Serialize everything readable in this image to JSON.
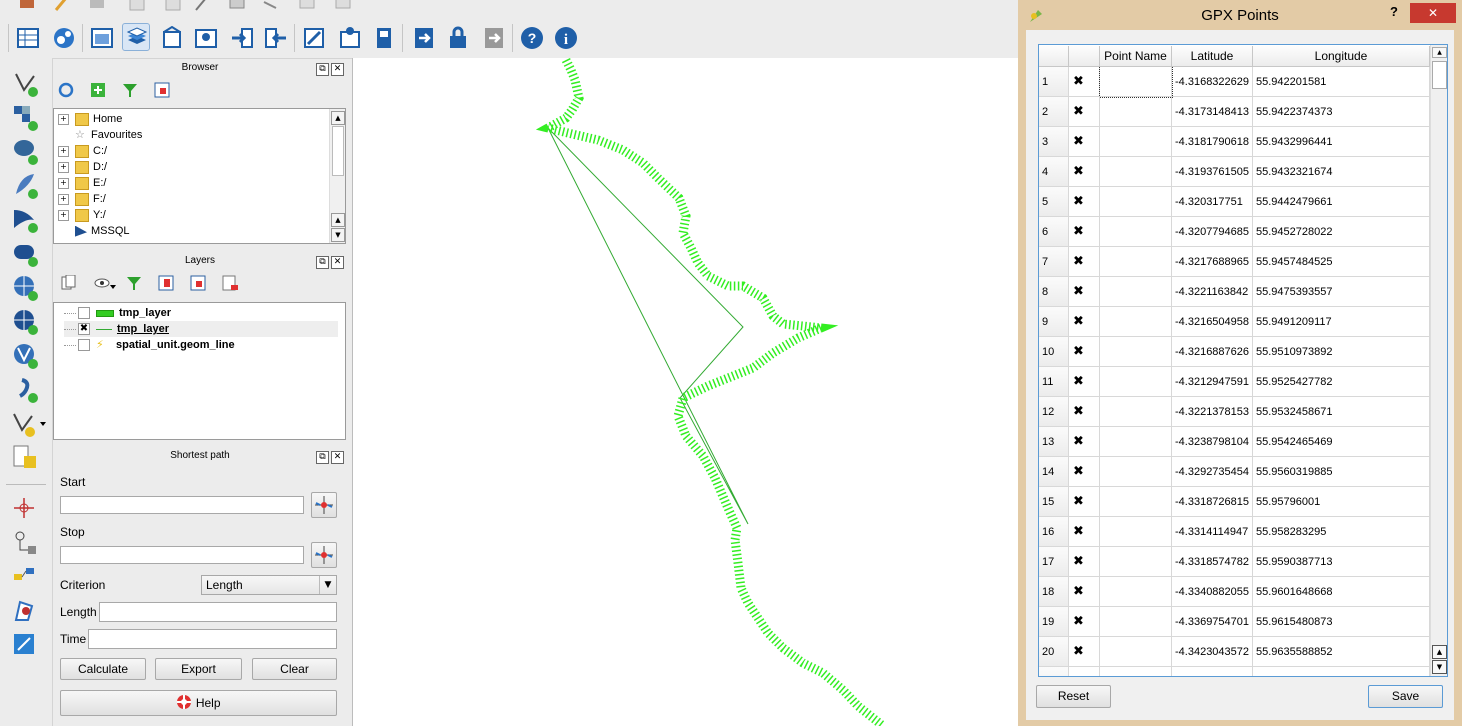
{
  "browser": {
    "title": "Browser",
    "items": [
      {
        "label": "Home",
        "expandable": true,
        "icon": "folder-icon"
      },
      {
        "label": "Favourites",
        "expandable": false,
        "icon": "star-icon"
      },
      {
        "label": "C:/",
        "expandable": true,
        "icon": "folder-icon"
      },
      {
        "label": "D:/",
        "expandable": true,
        "icon": "folder-icon"
      },
      {
        "label": "E:/",
        "expandable": true,
        "icon": "folder-icon"
      },
      {
        "label": "F:/",
        "expandable": true,
        "icon": "folder-icon"
      },
      {
        "label": "Y:/",
        "expandable": true,
        "icon": "folder-icon"
      },
      {
        "label": "MSSQL",
        "expandable": false,
        "icon": "mssql-icon"
      }
    ]
  },
  "layers": {
    "title": "Layers",
    "items": [
      {
        "label": "tmp_layer",
        "checked": false,
        "icon": "polygon-layer-icon"
      },
      {
        "label": "tmp_layer",
        "checked": true,
        "icon": "line-layer-icon"
      },
      {
        "label": "spatial_unit.geom_line",
        "checked": false,
        "icon": "line-layer-icon"
      }
    ]
  },
  "shortest_path": {
    "title": "Shortest path",
    "start_label": "Start",
    "start_value": "",
    "stop_label": "Stop",
    "stop_value": "",
    "criterion_label": "Criterion",
    "criterion_value": "Length",
    "length_label": "Length",
    "length_value": "",
    "time_label": "Time",
    "time_value": "",
    "calculate_label": "Calculate",
    "export_label": "Export",
    "clear_label": "Clear",
    "help_label": "Help"
  },
  "dialog": {
    "title": "GPX Points",
    "help_button": "?",
    "close_button": "✕",
    "columns": [
      "",
      "",
      "Point Name",
      "Latitude",
      "Longitude"
    ],
    "rows": [
      {
        "num": "1",
        "checked": true,
        "name": "",
        "lat": "-4.3168322629",
        "lon": "55.942201581"
      },
      {
        "num": "2",
        "checked": true,
        "name": "",
        "lat": "-4.3173148413",
        "lon": "55.9422374373"
      },
      {
        "num": "3",
        "checked": true,
        "name": "",
        "lat": "-4.3181790618",
        "lon": "55.9432996441"
      },
      {
        "num": "4",
        "checked": true,
        "name": "",
        "lat": "-4.3193761505",
        "lon": "55.9432321674"
      },
      {
        "num": "5",
        "checked": true,
        "name": "",
        "lat": "-4.320317751",
        "lon": "55.9442479661"
      },
      {
        "num": "6",
        "checked": true,
        "name": "",
        "lat": "-4.3207794685",
        "lon": "55.9452728022"
      },
      {
        "num": "7",
        "checked": true,
        "name": "",
        "lat": "-4.3217688965",
        "lon": "55.9457484525"
      },
      {
        "num": "8",
        "checked": true,
        "name": "",
        "lat": "-4.3221163842",
        "lon": "55.9475393557"
      },
      {
        "num": "9",
        "checked": true,
        "name": "",
        "lat": "-4.3216504958",
        "lon": "55.9491209117"
      },
      {
        "num": "10",
        "checked": true,
        "name": "",
        "lat": "-4.3216887626",
        "lon": "55.9510973892"
      },
      {
        "num": "11",
        "checked": true,
        "name": "",
        "lat": "-4.3212947591",
        "lon": "55.9525427782"
      },
      {
        "num": "12",
        "checked": true,
        "name": "",
        "lat": "-4.3221378153",
        "lon": "55.9532458671"
      },
      {
        "num": "13",
        "checked": true,
        "name": "",
        "lat": "-4.3238798104",
        "lon": "55.9542465469"
      },
      {
        "num": "14",
        "checked": true,
        "name": "",
        "lat": "-4.3292735454",
        "lon": "55.9560319885"
      },
      {
        "num": "15",
        "checked": true,
        "name": "",
        "lat": "-4.3318726815",
        "lon": "55.95796001"
      },
      {
        "num": "16",
        "checked": true,
        "name": "",
        "lat": "-4.3314114947",
        "lon": "55.958283295"
      },
      {
        "num": "17",
        "checked": true,
        "name": "",
        "lat": "-4.3318574782",
        "lon": "55.9590387713"
      },
      {
        "num": "18",
        "checked": true,
        "name": "",
        "lat": "-4.3340882055",
        "lon": "55.9601648668"
      },
      {
        "num": "19",
        "checked": true,
        "name": "",
        "lat": "-4.3369754701",
        "lon": "55.9615480873"
      },
      {
        "num": "20",
        "checked": true,
        "name": "",
        "lat": "-4.3423043572",
        "lon": "55.9635588852"
      }
    ],
    "reset_label": "Reset",
    "save_label": "Save"
  },
  "colors": {
    "map_line": "#33ee22",
    "dialog_frame": "#e3cba6",
    "selection_border": "#5b9bd5"
  }
}
